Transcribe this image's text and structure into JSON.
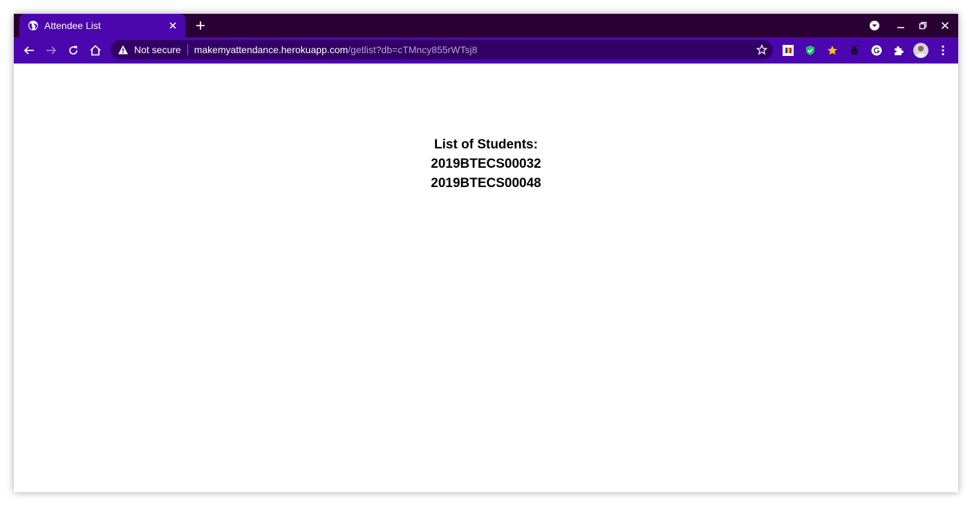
{
  "tab": {
    "title": "Attendee List",
    "favicon": "globe-icon"
  },
  "address_bar": {
    "security_label": "Not secure",
    "host": "makemyattendance.herokuapp.com",
    "path": "/getlist?db=cTMncy855rWTsj8"
  },
  "page": {
    "heading": "List of Students:",
    "students": [
      "2019BTECS00032",
      "2019BTECS00048"
    ]
  },
  "colors": {
    "frame": "#2a0034",
    "toolbar": "#4b06ad",
    "omnibox": "#320064",
    "page_background": "#ffffff"
  }
}
